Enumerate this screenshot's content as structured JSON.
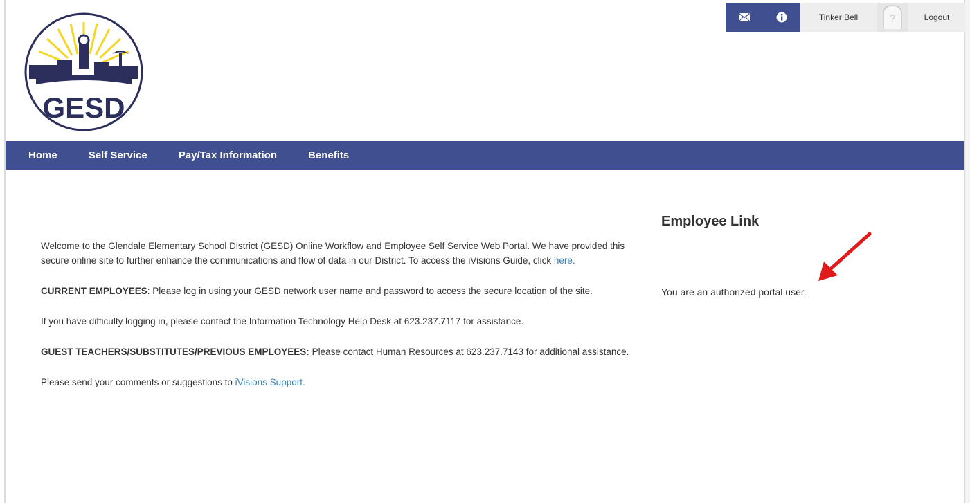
{
  "header": {
    "user_name": "Tinker Bell",
    "logout_label": "Logout",
    "icons": [
      "mail-icon",
      "info-icon",
      "avatar-placeholder-icon"
    ],
    "brand_color": "#3f4f8f"
  },
  "logo": {
    "text": "GESD"
  },
  "nav": {
    "home": "Home",
    "self_service": "Self Service",
    "pay_tax": "Pay/Tax Information",
    "benefits": "Benefits"
  },
  "main": {
    "welcome_text": "Welcome to the Glendale Elementary School District (GESD) Online Workflow and Employee Self Service Web Portal. We have provided this secure online site to further enhance the communications and flow of data in our District. To access the iVisions Guide, click ",
    "welcome_link": "here.",
    "current_label": "CURRENT EMPLOYEES",
    "current_text": ": Please log in using your GESD network user name and password to access the secure location of the site.",
    "difficulty_text": "If you have difficulty logging in, please contact the Information Technology Help Desk at 623.237.7117 for assistance.",
    "guest_label": "GUEST TEACHERS/SUBSTITUTES/PREVIOUS EMPLOYEES:",
    "guest_text": " Please contact Human Resources at 623.237.7143 for additional assistance.",
    "comments_text": "Please send your comments or suggestions to ",
    "comments_link": "iVisions Support."
  },
  "side": {
    "title": "Employee Link",
    "auth_message": "You are an authorized portal user.",
    "arrow_color": "#e01b1b"
  }
}
